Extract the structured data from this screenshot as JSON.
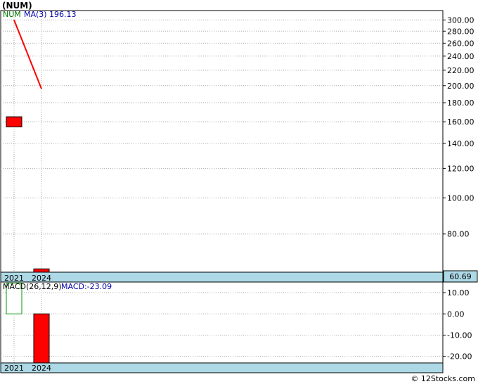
{
  "chart_data": [
    {
      "type": "candlestick",
      "title": "(NUM)",
      "legend": {
        "symbol": "NUM",
        "indicator": "MA(3)",
        "indicator_value": "196.13"
      },
      "y_scale": "log",
      "ylim": [
        63.2,
        318
      ],
      "y_ticks": [
        300,
        280,
        260,
        240,
        220,
        200,
        180,
        160,
        140,
        120,
        100,
        80
      ],
      "y_tick_labels": [
        "300.00",
        "280.00",
        "260.00",
        "240.00",
        "220.00",
        "200.00",
        "180.00",
        "160.00",
        "140.00",
        "120.00",
        "100.00",
        "80.00"
      ],
      "categories": [
        "2021",
        "2024"
      ],
      "candles": [
        {
          "year": "2021",
          "open": 165,
          "close": 155,
          "high": 165,
          "low": 155
        },
        {
          "year": "2024",
          "open": 64.5,
          "close": 60.69,
          "high": 64.5,
          "low": 60.69
        }
      ],
      "ma_series": {
        "name": "MA(3)",
        "points": [
          {
            "x": "2021",
            "y": 300
          },
          {
            "x": "2024",
            "y": 196.13
          }
        ]
      },
      "last_price": "60.69",
      "colors": {
        "down": "#ff0000",
        "up": "#009900",
        "ma": "#ff0000",
        "band": "#add8e6"
      }
    },
    {
      "type": "bar",
      "title": "MACD(26,12,9)",
      "value_label": "MACD:-23.09",
      "ylim": [
        -23.09,
        15
      ],
      "y_ticks": [
        10,
        0,
        -10,
        -20
      ],
      "y_tick_labels": [
        "10.00",
        "0.00",
        "-10.00",
        "-20.00"
      ],
      "categories": [
        "2021",
        "2024"
      ],
      "values": [
        14.5,
        -23.09
      ]
    }
  ],
  "footer": {
    "credit": "© 12Stocks.com"
  }
}
